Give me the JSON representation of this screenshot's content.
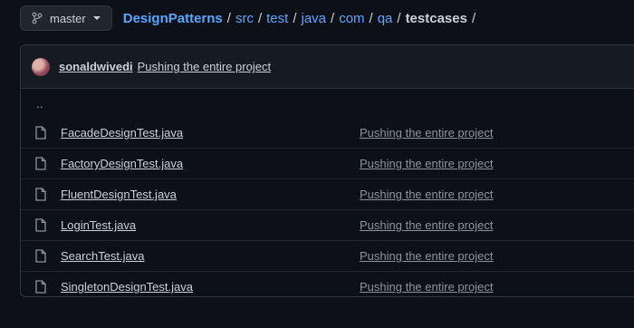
{
  "branch": {
    "label": "master",
    "icon": "git-branch-icon"
  },
  "breadcrumb": {
    "repo": "DesignPatterns",
    "parts": [
      "src",
      "test",
      "java",
      "com",
      "qa"
    ],
    "current": "testcases",
    "separator": "/"
  },
  "commit": {
    "user": "sonaldwivedi",
    "message": "Pushing the entire project"
  },
  "updir": "..",
  "files": [
    {
      "name": "FacadeDesignTest.java",
      "message": "Pushing the entire project"
    },
    {
      "name": "FactoryDesignTest.java",
      "message": "Pushing the entire project"
    },
    {
      "name": "FluentDesignTest.java",
      "message": "Pushing the entire project"
    },
    {
      "name": "LoginTest.java",
      "message": "Pushing the entire project"
    },
    {
      "name": "SearchTest.java",
      "message": "Pushing the entire project"
    },
    {
      "name": "SingletonDesignTest.java",
      "message": "Pushing the entire project"
    }
  ],
  "colors": {
    "background": "#0d1117",
    "link": "#58a6ff",
    "border": "#30363d"
  }
}
